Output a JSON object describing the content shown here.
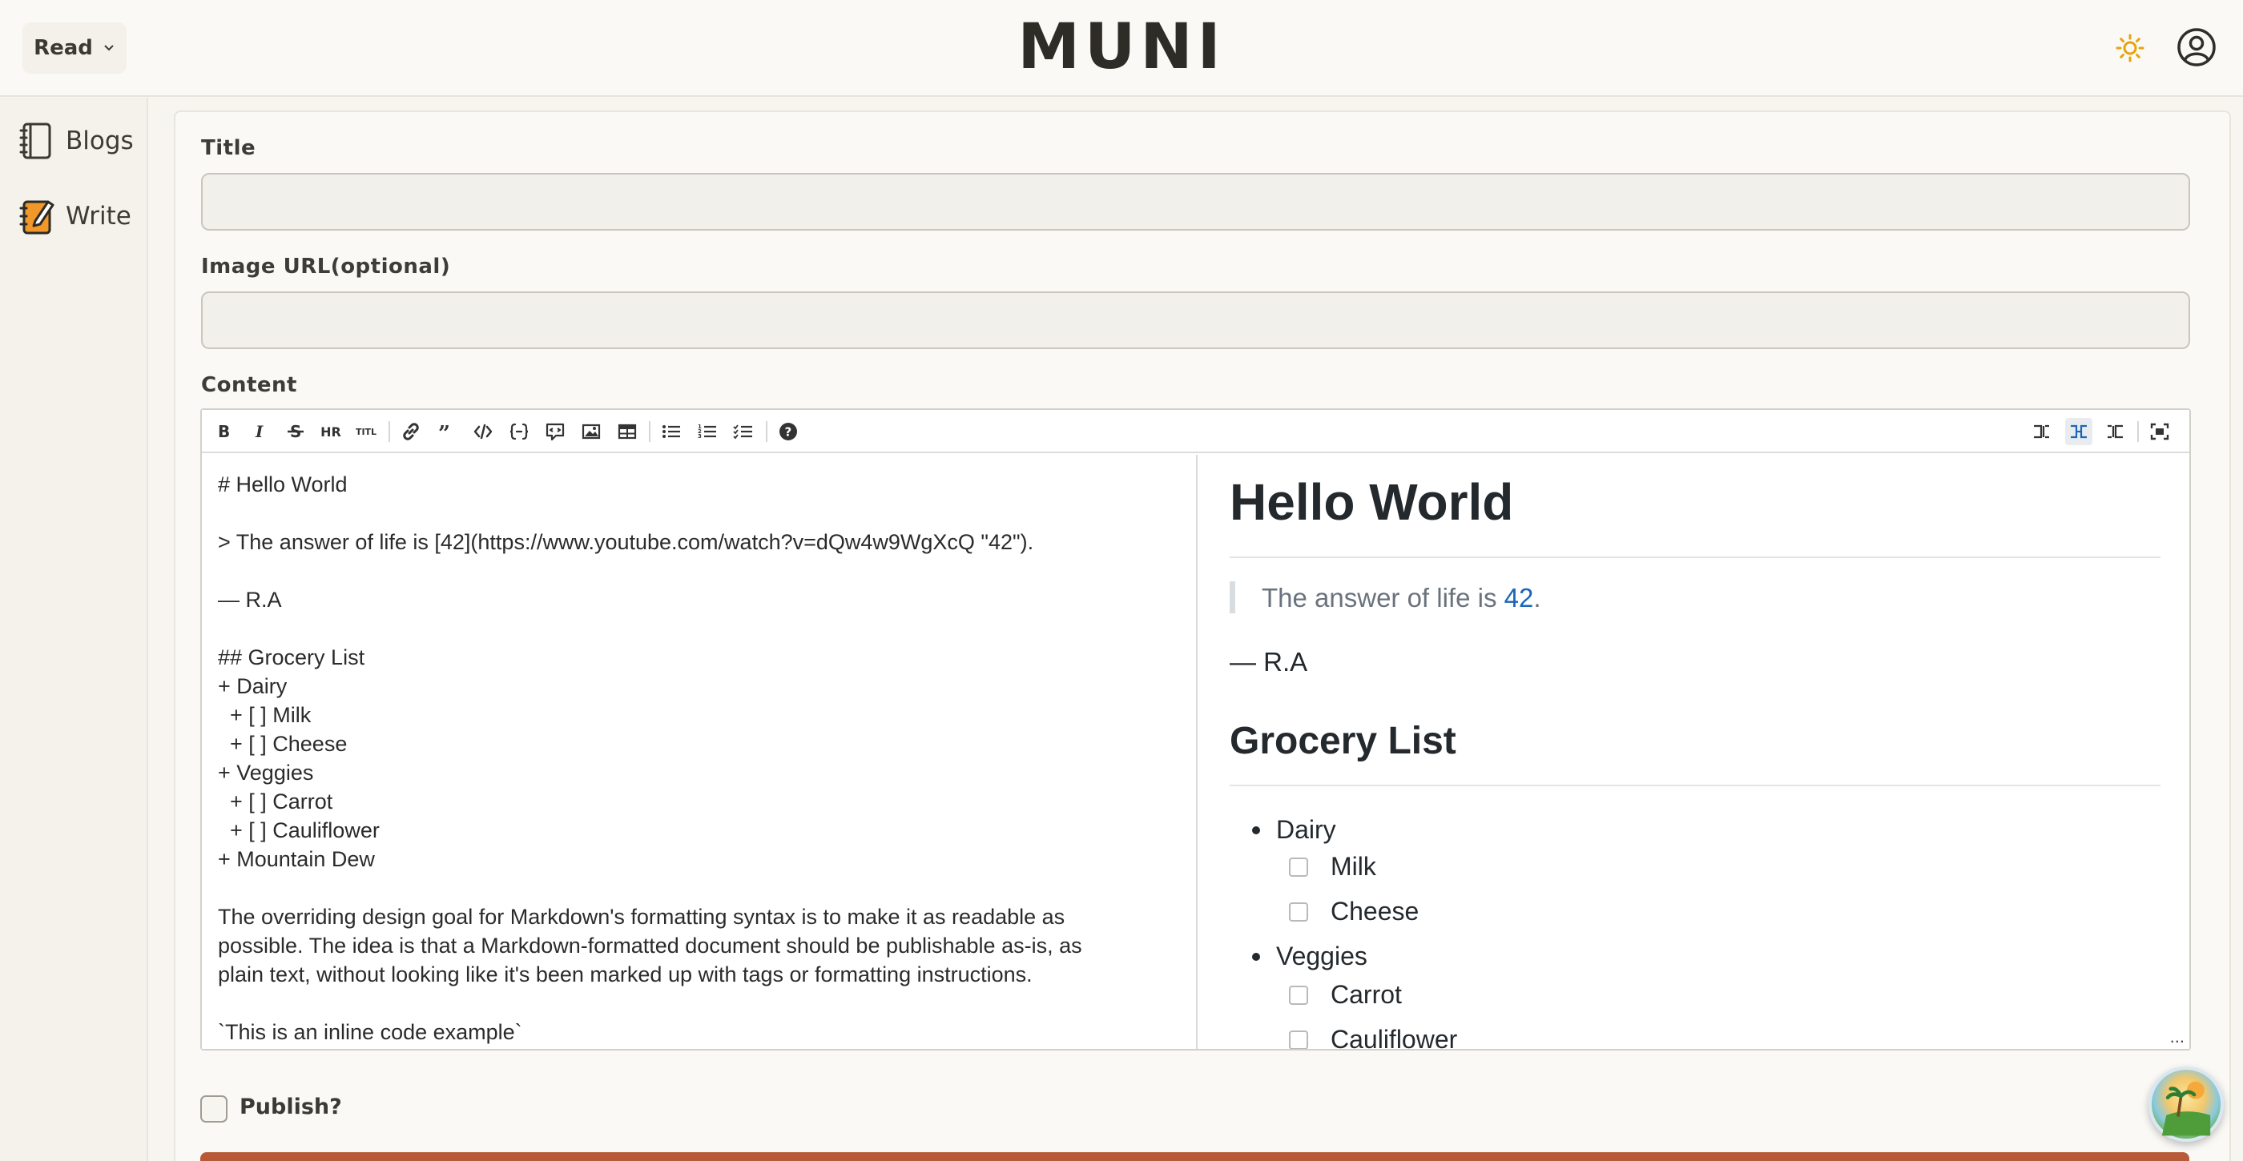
{
  "header": {
    "read_label": "Read",
    "logo": "MUNI",
    "theme_icon": "sun-icon",
    "account_icon": "user-circle-icon"
  },
  "sidebar": {
    "items": [
      {
        "label": "Blogs",
        "icon": "notebook-icon"
      },
      {
        "label": "Write",
        "icon": "pencil-notebook-icon"
      }
    ]
  },
  "form": {
    "title_label": "Title",
    "title_value": "",
    "image_label": "Image URL(optional)",
    "image_value": "",
    "content_label": "Content",
    "publish_label": "Publish?"
  },
  "toolbar": {
    "hr_text": "HR",
    "title_text": "TITL"
  },
  "editor": {
    "source_lines": [
      "# Hello World",
      "",
      "> The answer of life is [42](https://www.youtube.com/watch?v=dQw4w9WgXcQ \"42\").",
      "",
      "— R.A",
      "",
      "## Grocery List",
      "+ Dairy",
      "  + [ ] Milk",
      "  + [ ] Cheese",
      "+ Veggies",
      "  + [ ] Carrot",
      "  + [ ] Cauliflower",
      "+ Mountain Dew",
      "",
      "The overriding design goal for Markdown's formatting syntax is to make it as readable as",
      "possible. The idea is that a Markdown-formatted document should be publishable as-is, as",
      "plain text, without looking like it's been marked up with tags or formatting instructions.",
      "",
      "`This is an inline code example`"
    ],
    "preview": {
      "h1": "Hello World",
      "quote_prefix": "The answer of life is ",
      "quote_link": "42",
      "quote_suffix": ".",
      "attribution": "— R.A",
      "h2": "Grocery List",
      "items": {
        "dairy": "Dairy",
        "milk": "Milk",
        "cheese": "Cheese",
        "veggies": "Veggies",
        "carrot": "Carrot",
        "cauliflower": "Cauliflower"
      },
      "more": "..."
    }
  }
}
